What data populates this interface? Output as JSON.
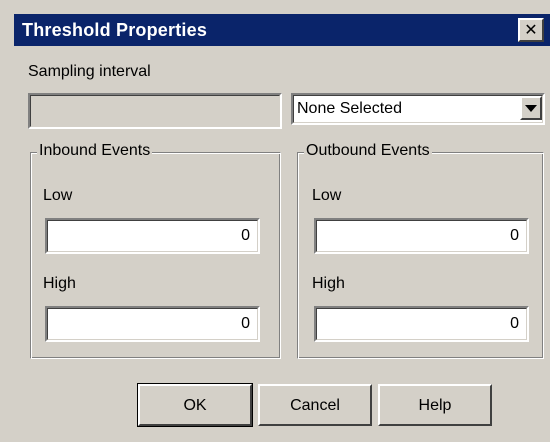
{
  "dialog": {
    "title": "Threshold Properties",
    "close_glyph": "✕"
  },
  "sampling": {
    "label": "Sampling interval",
    "value": "",
    "combo_value": "None Selected"
  },
  "inbound": {
    "title": "Inbound Events",
    "low_label": "Low",
    "low_value": "0",
    "high_label": "High",
    "high_value": "0"
  },
  "outbound": {
    "title": "Outbound Events",
    "low_label": "Low",
    "low_value": "0",
    "high_label": "High",
    "high_value": "0"
  },
  "buttons": {
    "ok": "OK",
    "cancel": "Cancel",
    "help": "Help"
  },
  "colors": {
    "titlebar": "#0a246a",
    "face": "#d4d0c8",
    "field": "#ffffff"
  },
  "icons": {
    "close": "close-icon",
    "dropdown": "chevron-down-icon"
  }
}
